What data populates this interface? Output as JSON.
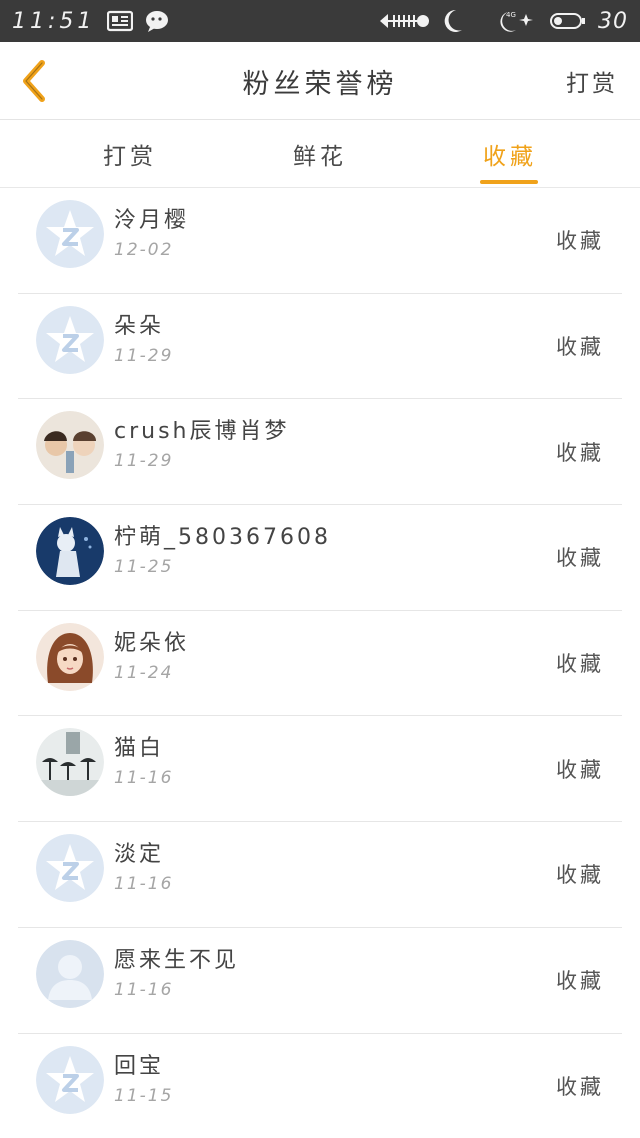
{
  "status_bar": {
    "time": "11:51",
    "battery": "30",
    "icons": [
      "news-icon",
      "wechat-icon",
      "fish-icon",
      "moon-icon",
      "signal-icon",
      "battery-icon"
    ]
  },
  "nav": {
    "title": "粉丝荣誉榜",
    "action": "打赏"
  },
  "tabs": [
    {
      "label": "打赏",
      "active": false
    },
    {
      "label": "鲜花",
      "active": false
    },
    {
      "label": "收藏",
      "active": true
    }
  ],
  "colors": {
    "accent": "#f0a21a",
    "status_bar": "#3a3a3a",
    "avatar_default": "#dfe8f3"
  },
  "rows": [
    {
      "name": "泠月樱",
      "date": "12-02",
      "action": "收藏",
      "avatar": "qq-star-avatar-icon"
    },
    {
      "name": "朵朵",
      "date": "11-29",
      "action": "收藏",
      "avatar": "qq-star-avatar-icon"
    },
    {
      "name": "crush辰博肖梦",
      "date": "11-29",
      "action": "收藏",
      "avatar": "photo-avatar-couple"
    },
    {
      "name": "柠萌_580367608",
      "date": "11-25",
      "action": "收藏",
      "avatar": "photo-avatar-anime"
    },
    {
      "name": "妮朵依",
      "date": "11-24",
      "action": "收藏",
      "avatar": "photo-avatar-girl"
    },
    {
      "name": "猫白",
      "date": "11-16",
      "action": "收藏",
      "avatar": "photo-avatar-umbrellas"
    },
    {
      "name": "淡定",
      "date": "11-16",
      "action": "收藏",
      "avatar": "qq-star-avatar-icon"
    },
    {
      "name": "愿来生不见",
      "date": "11-16",
      "action": "收藏",
      "avatar": "person-silhouette-avatar-icon"
    },
    {
      "name": "回宝",
      "date": "11-15",
      "action": "收藏",
      "avatar": "qq-star-avatar-icon"
    }
  ]
}
